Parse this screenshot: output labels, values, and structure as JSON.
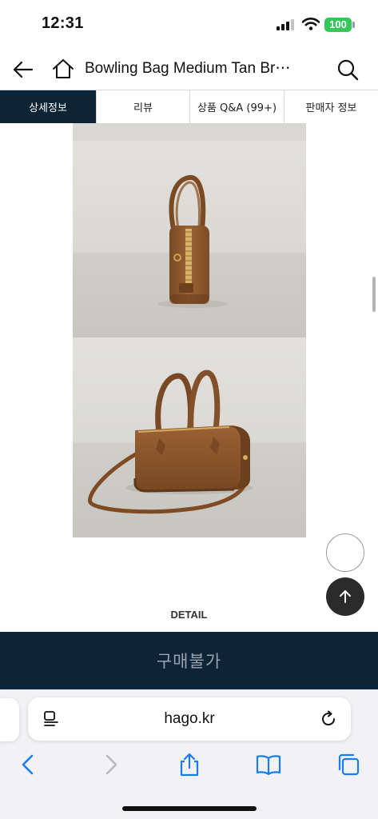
{
  "status_bar": {
    "time": "12:31",
    "battery": "100",
    "battery_color": "#34c759"
  },
  "header": {
    "title": "Bowling Bag Medium Tan Br⋯",
    "icons": [
      "back-arrow-icon",
      "home-icon",
      "search-icon"
    ]
  },
  "tabs": [
    {
      "label": "상세정보",
      "active": true
    },
    {
      "label": "리뷰",
      "active": false
    },
    {
      "label": "상품 Q&A (99+)",
      "active": false
    },
    {
      "label": "판매자 정보",
      "active": false
    }
  ],
  "content": {
    "images": [
      "bag-side-view-photo",
      "bag-front-three-quarter-photo"
    ],
    "detail_label": "DETAIL"
  },
  "buy_bar": {
    "label": "구매불가",
    "color": "#0d2336"
  },
  "safari": {
    "url": "hago.kr",
    "toolbar": [
      "back-icon",
      "forward-icon",
      "share-icon",
      "bookmarks-icon",
      "tabs-icon"
    ],
    "accent": "#1a7cf0"
  }
}
